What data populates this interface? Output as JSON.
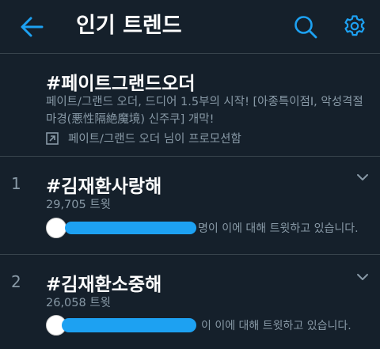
{
  "header": {
    "title": "인기 트렌드"
  },
  "trends": [
    {
      "name": "#페이트그랜드오더",
      "description": "페이트/그랜드 오더, 드디어 1.5부의 시작! [아종특이점Ⅰ, 악성격절마경(悪性隔絶魔境) 신주쿠] 개막!",
      "promoted_by": "페이트/그랜드 오더 님이 프로모션함"
    },
    {
      "rank": "1",
      "name": "#김재환사랑해",
      "tweet_count": "29,705 트윗",
      "mention_text": "명이 이에 대해 트윗하고 있습니다."
    },
    {
      "rank": "2",
      "name": "#김재환소중해",
      "tweet_count": "26,058 트윗",
      "mention_text": "이 이에 대해 트윗하고 있습니다."
    }
  ],
  "colors": {
    "background": "#15202b",
    "accent": "#1da1f2",
    "secondary_text": "#8899a6",
    "divider": "#38444d"
  },
  "icons": {
    "back": "arrow-left-icon",
    "search": "search-icon",
    "settings": "gear-icon",
    "promoted": "promoted-arrow-icon",
    "expand": "chevron-down-icon"
  }
}
